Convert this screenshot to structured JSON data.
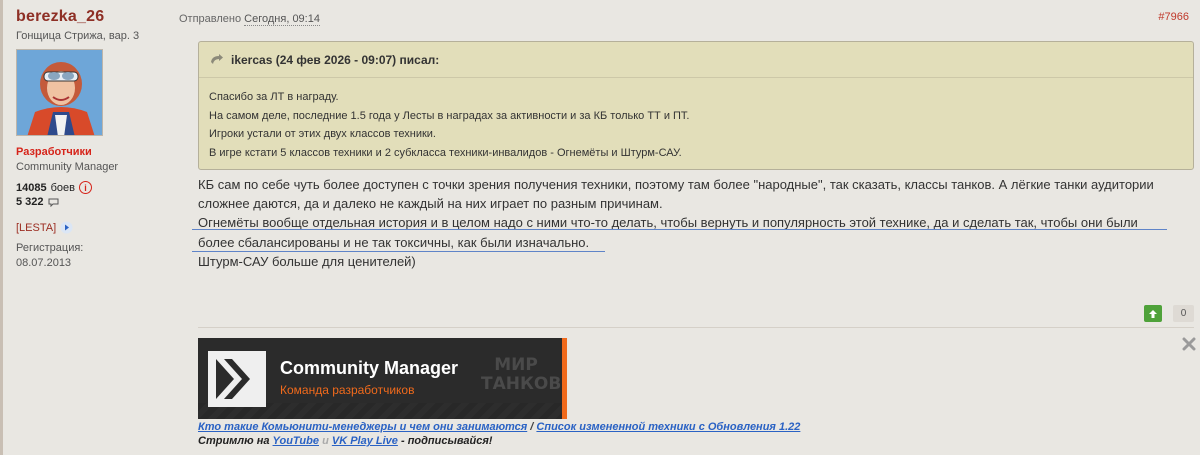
{
  "author": {
    "name": "berezka_26",
    "title": "Гонщица Стрижа, вар. 3",
    "group": "Разработчики",
    "role": "Community Manager",
    "battles_value": "14085",
    "battles_label": "боев",
    "posts_value": "5 322",
    "clan": "[LESTA]",
    "registration_label": "Регистрация:",
    "registration_date": "08.07.2013"
  },
  "post": {
    "sent_label": "Отправлено",
    "sent_time": "Сегодня, 09:14",
    "number": "#7966"
  },
  "quote": {
    "header": "ikercas (24 фев 2026 - 09:07) писал:",
    "lines": [
      "Спасибо за ЛТ в награду.",
      "На самом деле, последние 1.5 года у Лесты в наградах за активности и за КБ только ТТ и ПТ.",
      "Игроки устали от этих двух классов техники.",
      "В игре кстати 5 классов техники и  2 субкласса техники-инвалидов - Огнемёты и Штурм-САУ."
    ]
  },
  "body": {
    "lines": [
      "КБ сам по себе чуть более доступен с точки зрения получения техники, поэтому там более \"народные\", так сказать, классы танков. А лёгкие танки аудитории",
      "сложнее даются, да и далеко не каждый на них играет по разным причинам.",
      "Огнемёты вообще отдельная история и в целом надо с ними что-то делать, чтобы вернуть и популярность этой технике, да и сделать так, чтобы они были",
      "более сбалансированы и не так токсичны, как были изначально.",
      "Штурм-САУ больше для ценителей)"
    ]
  },
  "rating": {
    "count": "0"
  },
  "banner": {
    "title": "Community Manager",
    "subtitle": "Команда разработчиков",
    "mark_line1": "МИР",
    "mark_line2": "ТАНКОВ"
  },
  "signature": {
    "link1": "Кто такие Комьюнити-менеджеры и чем они занимаются",
    "divider": "/",
    "link2": "Список измененной техники с Обновления 1.22",
    "stream_prefix": "Стримлю на",
    "youtube": "YouTube",
    "and": "и",
    "vkplay": "VK Play Live",
    "stream_suffix": "- подписывайся!"
  },
  "colors": {
    "username": "#8e2f25",
    "group": "#d6241a",
    "link": "#2a62c4",
    "quote_bg": "#e2deba",
    "vote_up": "#4fa23a",
    "banner_accent": "#f06a1c"
  }
}
